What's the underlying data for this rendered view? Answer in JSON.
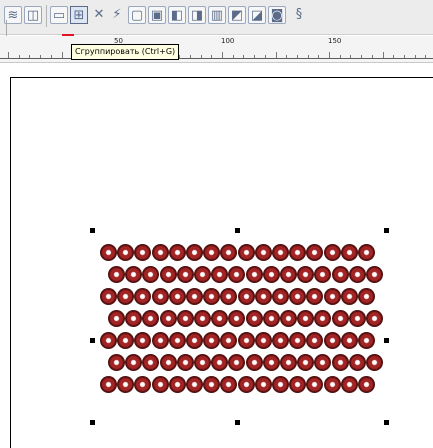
{
  "toolbar": {
    "icons": [
      "rotate-icon",
      "mirror-icon",
      "group-icon",
      "ungroup-icon",
      "ungroup-all-icon",
      "align-left-icon",
      "align-center-icon",
      "align-right-icon",
      "align-top-icon",
      "distribute-icon",
      "order-front-icon",
      "order-back-icon",
      "combine-icon"
    ]
  },
  "ruler": {
    "labels": [
      "50",
      "100",
      "150"
    ]
  },
  "tooltip": {
    "text": "Сгруппировать (Ctrl+G)"
  },
  "colors": {
    "accent": "#e4141e",
    "dot_fill": "#a32424",
    "dot_dark": "#101010"
  },
  "pattern": {
    "rows": 7,
    "columns": 16
  }
}
